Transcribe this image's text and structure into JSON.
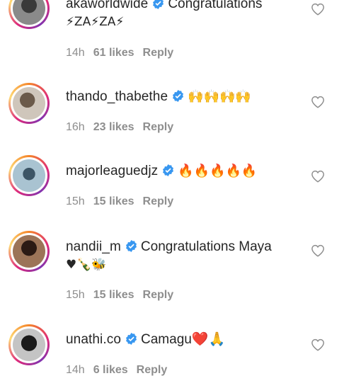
{
  "comments": [
    {
      "username": "akaworldwide",
      "text": "Congratulations",
      "line2": "⚡ZA⚡ZA⚡",
      "time": "14h",
      "likes": "61 likes",
      "reply": "Reply",
      "avatar_colors": [
        "#2a2a2a",
        "#555555"
      ]
    },
    {
      "username": "thando_thabethe",
      "text": "🙌🙌🙌🙌",
      "line2": "",
      "time": "16h",
      "likes": "23 likes",
      "reply": "Reply",
      "avatar_colors": [
        "#8a7a6a",
        "#d9d2c8"
      ]
    },
    {
      "username": "majorleaguedjz",
      "text": "🔥🔥🔥🔥🔥",
      "line2": "",
      "time": "15h",
      "likes": "15 likes",
      "reply": "Reply",
      "avatar_colors": [
        "#6a8fa8",
        "#c8d8e2"
      ]
    },
    {
      "username": "nandii_m",
      "text": "Congratulations Maya",
      "line2": "♥🍾🐝",
      "time": "15h",
      "likes": "15 likes",
      "reply": "Reply",
      "avatar_colors": [
        "#3a2620",
        "#b58b6a"
      ]
    },
    {
      "username": "unathi.co",
      "text": "Camagu❤️🙏",
      "line2": "",
      "time": "14h",
      "likes": "6 likes",
      "reply": "Reply",
      "avatar_colors": [
        "#1a1a1a",
        "#bdbdbd"
      ]
    }
  ],
  "colors": {
    "verified": "#3897f0",
    "meta": "#8e8e8e",
    "text": "#262626"
  }
}
